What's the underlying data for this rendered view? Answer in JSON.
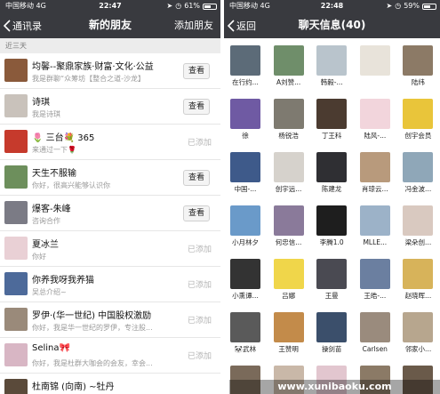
{
  "left": {
    "status": {
      "carrier": "中国移动",
      "network": "4G",
      "time": "22:47",
      "battery": "61%",
      "battery_level": 0.61
    },
    "nav": {
      "back_label": "通讯录",
      "title": "新的朋友",
      "action_label": "添加朋友"
    },
    "section_header": "近三天",
    "requests": [
      {
        "name": "均馨--聚鼎家族·财富·文化·公益",
        "message": "我是群聊“众筹坊【整合之道-沙龙】",
        "action": "查看",
        "status": "pending",
        "avatar_color": "#8a5a3b"
      },
      {
        "name": "诗琪",
        "message": "我是诗琪",
        "action": "查看",
        "status": "pending",
        "avatar_color": "#c9c2bb"
      },
      {
        "name": "🌷 三台💐 365",
        "message": "来通过一下🌹",
        "action": "已添加",
        "status": "added",
        "avatar_color": "#c63a2c"
      },
      {
        "name": "天生不服输",
        "message": "你好，很高兴能够认识你",
        "action": "查看",
        "status": "pending",
        "avatar_color": "#6d8f5c"
      },
      {
        "name": "爆客-朱峰",
        "message": "咨询合作",
        "action": "查看",
        "status": "pending",
        "avatar_color": "#7b7b85"
      },
      {
        "name": "夏冰兰",
        "message": "你好",
        "action": "已添加",
        "status": "added",
        "avatar_color": "#e9d0d5"
      },
      {
        "name": "你养我呀我养猫",
        "message": "吴总介绍~",
        "action": "已添加",
        "status": "added",
        "avatar_color": "#4d6a9a"
      },
      {
        "name": "罗伊·(华一世纪) 中国股权激励",
        "message": "你好，我是华一世纪的罗伊，专注股...",
        "action": "已添加",
        "status": "added",
        "avatar_color": "#9a8a7a"
      },
      {
        "name": "Selina🎀",
        "message": "你好，我是杜群大咖会的会友，幸会...",
        "action": "已添加",
        "status": "added",
        "avatar_color": "#d8b6c4"
      },
      {
        "name": "杜南锦 (向南) ~牡丹",
        "message": "",
        "action": "",
        "status": "pending",
        "avatar_color": "#5a4a3a"
      }
    ]
  },
  "right": {
    "status": {
      "carrier": "中国移动",
      "network": "4G",
      "time": "22:48",
      "battery": "59%",
      "battery_level": 0.59
    },
    "nav": {
      "back_label": "返回",
      "title": "聊天信息(40)"
    },
    "members": [
      {
        "name": "在行约...",
        "color": "#5c6b78"
      },
      {
        "name": "A刘赞...",
        "color": "#6f8e6a"
      },
      {
        "name": "韩毅-...",
        "color": "#b9c4cc"
      },
      {
        "name": "",
        "color": "#e8e3da"
      },
      {
        "name": "陆纬",
        "color": "#8c7a66"
      },
      {
        "name": "徐",
        "color": "#6f5aa3"
      },
      {
        "name": "杨锐浩",
        "color": "#7e7a70"
      },
      {
        "name": "丁王科",
        "color": "#4b3b30"
      },
      {
        "name": "陆风-...",
        "color": "#f2d5dc"
      },
      {
        "name": "创宇会员",
        "color": "#e9c53a"
      },
      {
        "name": "中国-...",
        "color": "#3e5a8a"
      },
      {
        "name": "创宇远...",
        "color": "#d6d2cc"
      },
      {
        "name": "陈建龙",
        "color": "#2f2f33"
      },
      {
        "name": "肖琼云...",
        "color": "#b89a7c"
      },
      {
        "name": "冯金波...",
        "color": "#8fa7b8"
      },
      {
        "name": "小月林夕",
        "color": "#6a9ac9"
      },
      {
        "name": "何忠信...",
        "color": "#8a7a9a"
      },
      {
        "name": "李腾1.0",
        "color": "#1e1e1e"
      },
      {
        "name": "MLLE...",
        "color": "#9cb2c8"
      },
      {
        "name": "梁朵创...",
        "color": "#d9c9c0"
      },
      {
        "name": "小熏谭...",
        "color": "#333333"
      },
      {
        "name": "吕娜",
        "color": "#f0d64a"
      },
      {
        "name": "王曼",
        "color": "#4a4a52"
      },
      {
        "name": "王皓-...",
        "color": "#6b7fa0"
      },
      {
        "name": "赵晓晖...",
        "color": "#d7b35a"
      },
      {
        "name": "🐼武林",
        "color": "#5a5a5a"
      },
      {
        "name": "王赞明",
        "color": "#c38b4a"
      },
      {
        "name": "操剑苗",
        "color": "#3b4f6b"
      },
      {
        "name": "Carlsen",
        "color": "#9a8b7d"
      },
      {
        "name": "邻家小...",
        "color": "#b7a68e"
      },
      {
        "name": "",
        "color": "#7a6a5a"
      },
      {
        "name": "",
        "color": "#c9b8a8"
      },
      {
        "name": "",
        "color": "#e2c6cf"
      },
      {
        "name": "",
        "color": "#8b7a66"
      },
      {
        "name": "",
        "color": "#6a5a4a"
      }
    ]
  },
  "watermark": "www.xunibaoku.com"
}
